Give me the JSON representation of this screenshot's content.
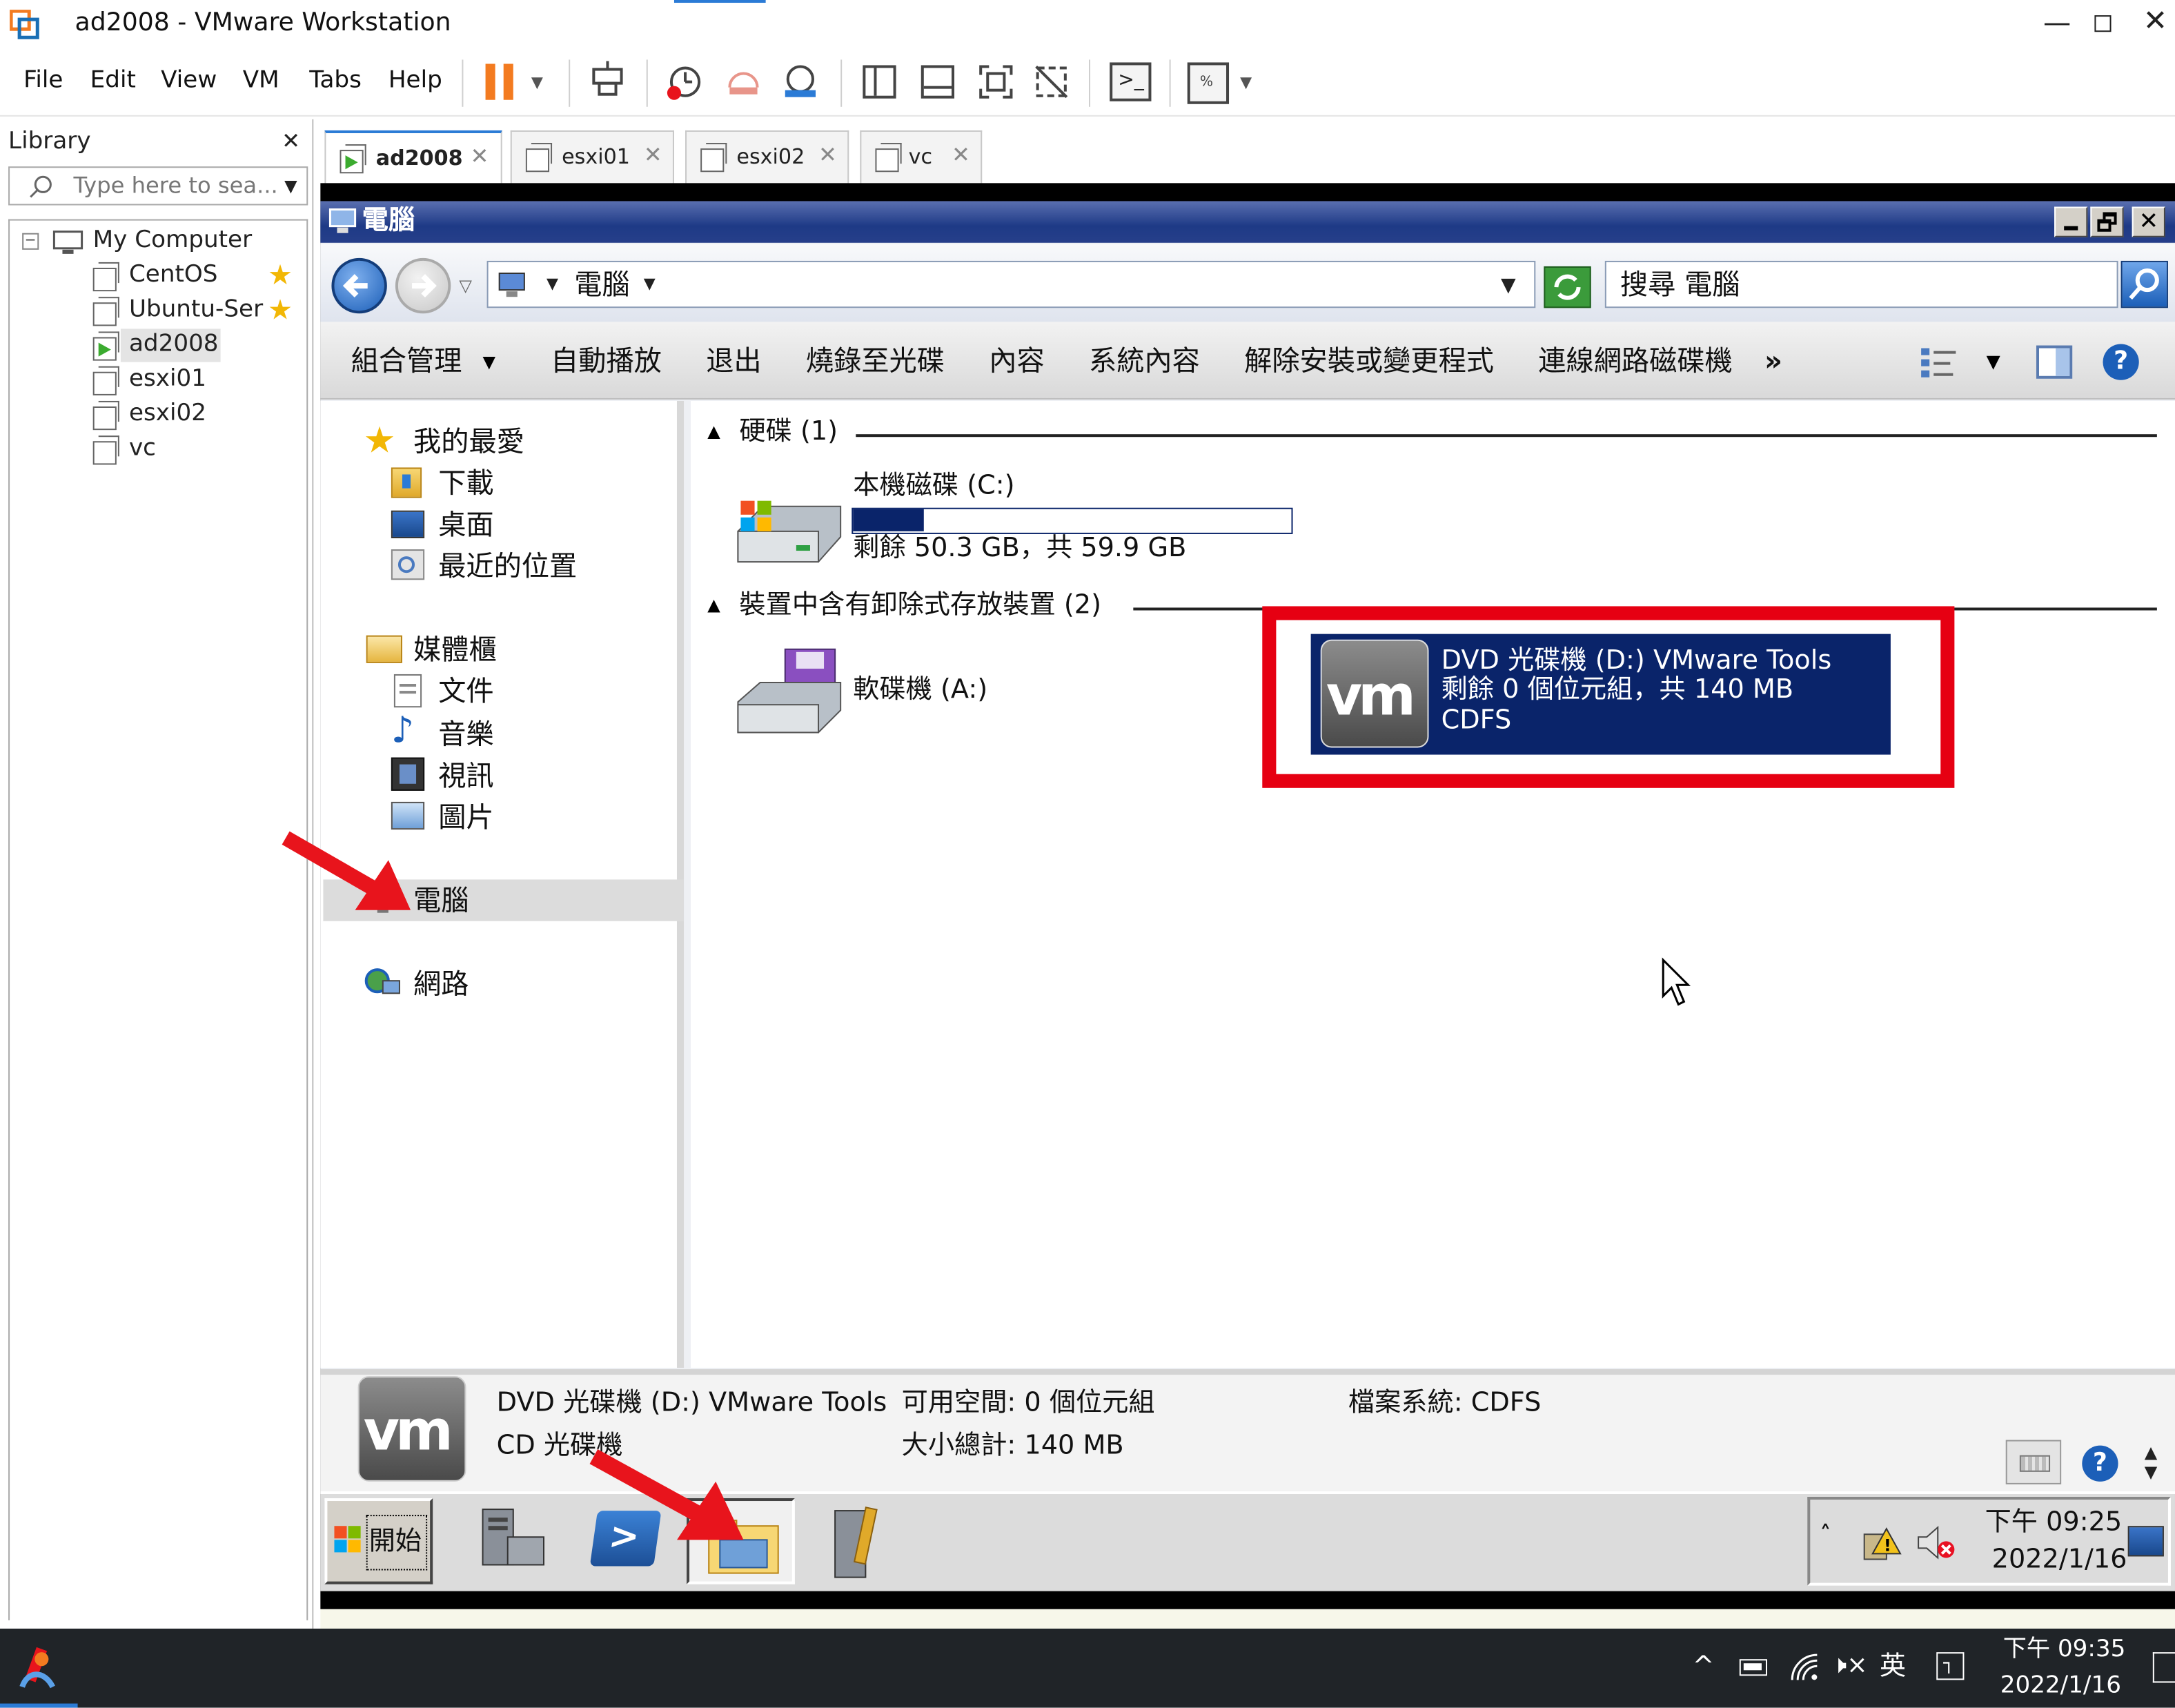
{
  "window": {
    "title": "ad2008 - VMware Workstation"
  },
  "menu": {
    "items": [
      "File",
      "Edit",
      "View",
      "VM",
      "Tabs",
      "Help"
    ]
  },
  "library": {
    "title": "Library",
    "search_placeholder": "Type here to sea...",
    "root": "My Computer",
    "vms": [
      "CentOS",
      "Ubuntu-Ser",
      "ad2008",
      "esxi01",
      "esxi02",
      "vc"
    ]
  },
  "tabs": [
    "ad2008",
    "esxi01",
    "esxi02",
    "vc"
  ],
  "guest": {
    "window_title": "電腦",
    "address": "電腦",
    "search_placeholder": "搜尋 電腦",
    "commands": [
      "組合管理",
      "自動播放",
      "退出",
      "燒錄至光碟",
      "內容",
      "系統內容",
      "解除安裝或變更程式",
      "連線網路磁碟機"
    ],
    "more": "»",
    "nav": {
      "favorites": "我的最愛",
      "fav_items": [
        "下載",
        "桌面",
        "最近的位置"
      ],
      "libraries": "媒體櫃",
      "lib_items": [
        "文件",
        "音樂",
        "視訊",
        "圖片"
      ],
      "computer": "電腦",
      "network": "網路"
    },
    "hdd_group": "硬碟 (1)",
    "local_disk": {
      "name": "本機磁碟 (C:)",
      "free": "剩餘 50.3 GB，共 59.9 GB",
      "used_fraction": 0.16
    },
    "removable_group": "裝置中含有卸除式存放裝置 (2)",
    "floppy": "軟碟機 (A:)",
    "dvd": {
      "name": "DVD 光碟機 (D:) VMware Tools",
      "free": "剩餘 0 個位元組，共 140 MB",
      "fs": "CDFS"
    },
    "details": {
      "name": "DVD 光碟機 (D:) VMware Tools",
      "type": "CD 光碟機",
      "free_label": "可用空間: 0 個位元組",
      "size_label": "大小總計: 140 MB",
      "fs_label": "檔案系統: CDFS"
    },
    "taskbar": {
      "start": "開始",
      "time": "下午 09:25",
      "date": "2022/1/16"
    }
  },
  "host_taskbar": {
    "ime": "英",
    "time": "下午 09:35",
    "date": "2022/1/16"
  },
  "colors": {
    "highlight_box": "#e60012",
    "selection": "#0a246a",
    "arrow": "#e8141c",
    "vmware_orange": "#f37b20"
  }
}
